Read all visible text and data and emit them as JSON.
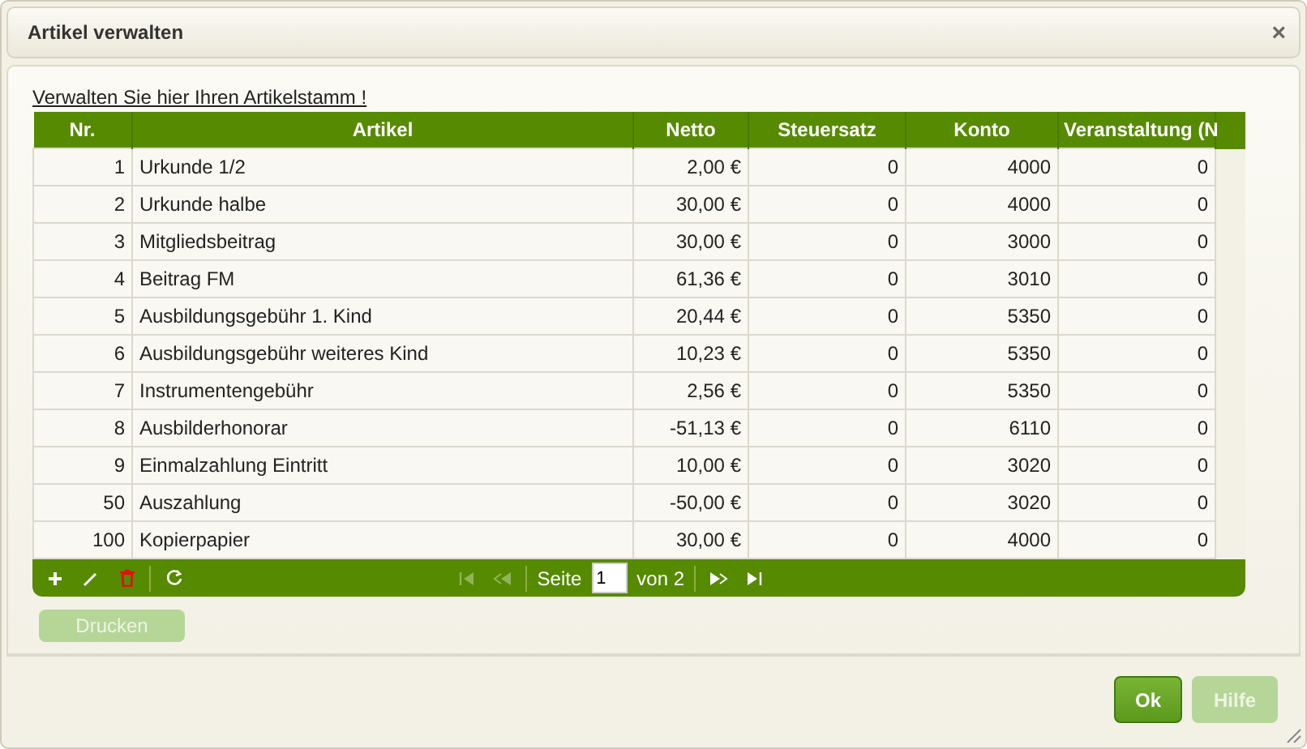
{
  "window": {
    "title": "Artikel verwalten",
    "close": "×"
  },
  "intro_link": "Verwalten Sie hier Ihren Artikelstamm !",
  "table": {
    "columns": [
      "Nr.",
      "Artikel",
      "Netto",
      "Steuersatz",
      "Konto",
      "Veranstaltung (N"
    ],
    "rows": [
      [
        "1",
        "Urkunde 1/2",
        "2,00 €",
        "0",
        "4000",
        "0"
      ],
      [
        "2",
        "Urkunde halbe",
        "30,00 €",
        "0",
        "4000",
        "0"
      ],
      [
        "3",
        "Mitgliedsbeitrag",
        "30,00 €",
        "0",
        "3000",
        "0"
      ],
      [
        "4",
        "Beitrag FM",
        "61,36 €",
        "0",
        "3010",
        "0"
      ],
      [
        "5",
        "Ausbildungsgebühr 1. Kind",
        "20,44 €",
        "0",
        "5350",
        "0"
      ],
      [
        "6",
        "Ausbildungsgebühr weiteres Kind",
        "10,23 €",
        "0",
        "5350",
        "0"
      ],
      [
        "7",
        "Instrumentengebühr",
        "2,56 €",
        "0",
        "5350",
        "0"
      ],
      [
        "8",
        "Ausbilderhonorar",
        "-51,13 €",
        "0",
        "6110",
        "0"
      ],
      [
        "9",
        "Einmalzahlung Eintritt",
        "10,00 €",
        "0",
        "3020",
        "0"
      ],
      [
        "50",
        "Auszahlung",
        "-50,00 €",
        "0",
        "3020",
        "0"
      ],
      [
        "100",
        "Kopierpapier",
        "30,00 €",
        "0",
        "4000",
        "0"
      ]
    ]
  },
  "toolbar": {
    "actions": [
      {
        "kind": "add",
        "disabled": false
      },
      {
        "kind": "edit",
        "disabled": false
      },
      {
        "kind": "delete",
        "disabled": false
      },
      {
        "kind": "refresh",
        "disabled": false
      }
    ],
    "pager": {
      "first_disabled": true,
      "prev_disabled": true,
      "next_disabled": false,
      "last_disabled": false,
      "page_label": "Seite",
      "page": "1",
      "total": "von 2"
    }
  },
  "print_button": {
    "label": "Drucken",
    "disabled": true
  },
  "buttons": [
    {
      "label": "Ok",
      "disabled": false
    },
    {
      "label": "Hilfe",
      "disabled": true
    }
  ]
}
